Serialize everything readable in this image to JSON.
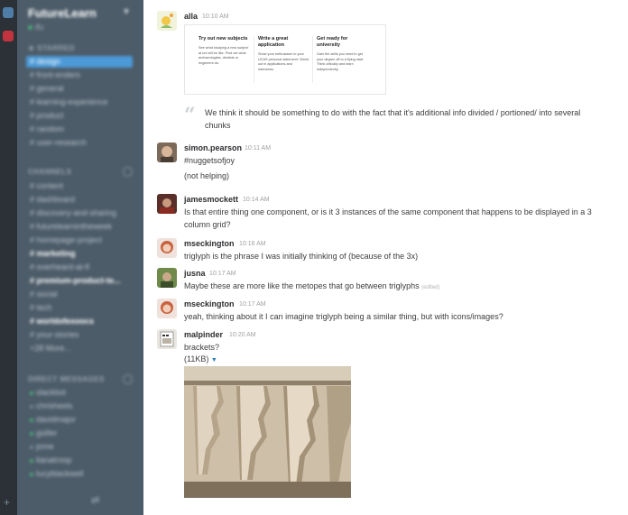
{
  "sidebar": {
    "team_name": "FutureLearn",
    "status": "ifu",
    "starred_header": "STARRED",
    "starred": [
      {
        "label": "# design",
        "active": true
      },
      {
        "label": "# front-enders"
      },
      {
        "label": "# general"
      },
      {
        "label": "# learning-experience"
      },
      {
        "label": "# product"
      },
      {
        "label": "# random"
      },
      {
        "label": "# user-research"
      }
    ],
    "channels_header": "CHANNELS",
    "channels": [
      {
        "label": "# content"
      },
      {
        "label": "# dashboard"
      },
      {
        "label": "# discovery-and-sharing"
      },
      {
        "label": "# futurelearnintheweek"
      },
      {
        "label": "# homepage-project"
      },
      {
        "label": "# marketing",
        "bold": true
      },
      {
        "label": "# overheard-at-fl"
      },
      {
        "label": "# premium-product-te...",
        "bold": true
      },
      {
        "label": "# social"
      },
      {
        "label": "# tech"
      },
      {
        "label": "# worldofexoocs",
        "bold": true
      },
      {
        "label": "# your-stories"
      },
      {
        "label": "+28 More..."
      }
    ],
    "dm_header": "DIRECT MESSAGES",
    "dms": [
      {
        "label": "slackbot",
        "online": true
      },
      {
        "label": "chrisheels",
        "online": false
      },
      {
        "label": "davidmajor",
        "online": true
      },
      {
        "label": "gsiller",
        "online": true
      },
      {
        "label": "jome",
        "online": false
      },
      {
        "label": "lianatroop",
        "online": true
      },
      {
        "label": "lucyblackwell",
        "online": true
      }
    ]
  },
  "messages": [
    {
      "user": "alla",
      "time": "10:10 AM"
    },
    {
      "user": "simon.pearson",
      "time": "10:11 AM"
    },
    {
      "user": "jamesmockett",
      "time": "10:14 AM"
    },
    {
      "user": "mseckington",
      "time": "10:16 AM"
    },
    {
      "user": "jusna",
      "time": "10:17 AM"
    },
    {
      "user": "mseckington",
      "time": "10:17 AM"
    },
    {
      "user": "malpinder",
      "time": "10:20 AM"
    }
  ],
  "alla": {
    "card": [
      {
        "title": "Try out new subjects",
        "text": "See what studying a new subject at uni will be like. Find out what archaeologists, dentists or engineers do."
      },
      {
        "title": "Write a great application",
        "text": "Show your enthusiasm in your UCAS personal statement. Stand out in applications and interviews."
      },
      {
        "title": "Get ready for university",
        "text": "Gain the skills you need to get your degree off to a flying start. Think critically and learn independently."
      }
    ],
    "quote": "We think it should be something to do with the fact that it's additional info divided / portioned/ into several chunks"
  },
  "simon": {
    "line1": "#nuggetsofjoy",
    "line2": "(not helping)"
  },
  "james": {
    "line1": "Is that entire thing one component, or is it 3 instances of the same component that happens to be displayed in a 3",
    "line2": "column grid?"
  },
  "mseck1": {
    "text": "triglyph is the phrase I was initially thinking of (because of the 3x)"
  },
  "jusna": {
    "text": "Maybe these are more like the metopes that go between triglyphs",
    "edited": "(edited)"
  },
  "mseck2": {
    "text": "yeah, thinking about it I can imagine triglyph being a similar thing, but with icons/images?"
  },
  "malpinder": {
    "text": "brackets?",
    "size": "(11KB)"
  },
  "colors": {
    "sidebar": "#4d5c69",
    "active_channel": "#4c9ad8",
    "team_rail": "#2b3137"
  }
}
